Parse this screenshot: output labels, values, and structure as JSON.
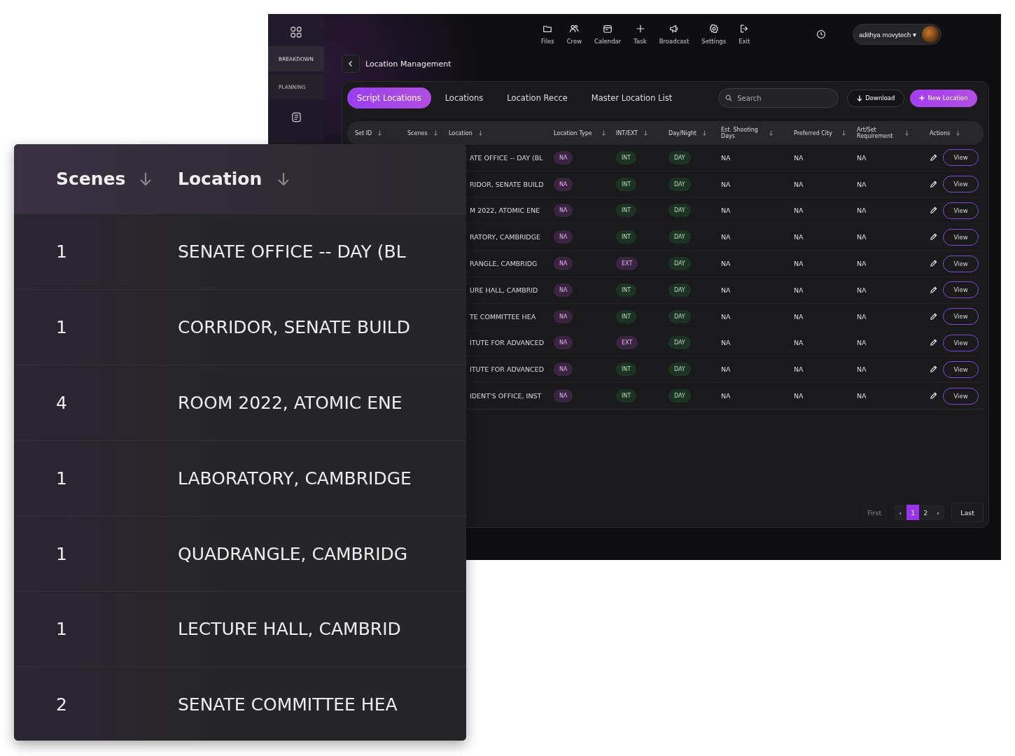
{
  "sidebar": {
    "items": [
      {
        "label": "BREAKDOWN",
        "selected": true
      },
      {
        "label": "PLANNING",
        "selected": false
      }
    ]
  },
  "nav": [
    {
      "label": "Files"
    },
    {
      "label": "Crew"
    },
    {
      "label": "Calendar"
    },
    {
      "label": "Task"
    },
    {
      "label": "Broadcast"
    },
    {
      "label": "Settings"
    },
    {
      "label": "Exit"
    }
  ],
  "user": {
    "name": "adithya movytech ▾"
  },
  "page_title": "Location Management",
  "tabs": [
    {
      "label": "Script Locations",
      "selected": true
    },
    {
      "label": "Locations",
      "selected": false
    },
    {
      "label": "Location Recce",
      "selected": false
    },
    {
      "label": "Master Location List",
      "selected": false
    }
  ],
  "search": {
    "placeholder": "Search"
  },
  "buttons": {
    "download": "Download",
    "new": "New Location"
  },
  "table": {
    "columns": [
      "Set ID",
      "Scenes",
      "Location",
      "Location Type",
      "INT/EXT",
      "Day/Night",
      "Est. Shooting Days",
      "Preferred City",
      "Art/Set Requirement",
      "Actions"
    ],
    "rows": [
      {
        "location": "ATE OFFICE -- DAY (BL",
        "location_type": "NA",
        "setting": {
          "label": "INT",
          "kind": "interior"
        },
        "time": "DAY",
        "days": "NA",
        "city": "NA",
        "art": "NA",
        "action": "View"
      },
      {
        "location": "RIDOR, SENATE BUILD",
        "location_type": "NA",
        "setting": {
          "label": "INT",
          "kind": "interior"
        },
        "time": "DAY",
        "days": "NA",
        "city": "NA",
        "art": "NA",
        "action": "View"
      },
      {
        "location": "M 2022, ATOMIC ENE",
        "location_type": "NA",
        "setting": {
          "label": "INT",
          "kind": "interior"
        },
        "time": "DAY",
        "days": "NA",
        "city": "NA",
        "art": "NA",
        "action": "View"
      },
      {
        "location": "RATORY, CAMBRIDGE",
        "location_type": "NA",
        "setting": {
          "label": "INT",
          "kind": "interior"
        },
        "time": "DAY",
        "days": "NA",
        "city": "NA",
        "art": "NA",
        "action": "View"
      },
      {
        "location": "RANGLE, CAMBRIDG",
        "location_type": "NA",
        "setting": {
          "label": "EXT",
          "kind": "exterior"
        },
        "time": "DAY",
        "days": "NA",
        "city": "NA",
        "art": "NA",
        "action": "View"
      },
      {
        "location": "URE HALL, CAMBRID",
        "location_type": "NA",
        "setting": {
          "label": "INT",
          "kind": "interior"
        },
        "time": "DAY",
        "days": "NA",
        "city": "NA",
        "art": "NA",
        "action": "View"
      },
      {
        "location": "TE COMMITTEE HEA",
        "location_type": "NA",
        "setting": {
          "label": "INT",
          "kind": "interior"
        },
        "time": "DAY",
        "days": "NA",
        "city": "NA",
        "art": "NA",
        "action": "View"
      },
      {
        "location": "ITUTE FOR ADVANCED",
        "location_type": "NA",
        "setting": {
          "label": "EXT",
          "kind": "exterior"
        },
        "time": "DAY",
        "days": "NA",
        "city": "NA",
        "art": "NA",
        "action": "View"
      },
      {
        "location": "ITUTE FOR ADVANCED",
        "location_type": "NA",
        "setting": {
          "label": "INT",
          "kind": "interior"
        },
        "time": "DAY",
        "days": "NA",
        "city": "NA",
        "art": "NA",
        "action": "View"
      },
      {
        "location": "IDENT'S OFFICE, INST",
        "location_type": "NA",
        "setting": {
          "label": "INT",
          "kind": "interior"
        },
        "time": "DAY",
        "days": "NA",
        "city": "NA",
        "art": "NA",
        "action": "View"
      }
    ]
  },
  "pagination": {
    "first": "First",
    "prev": "‹",
    "pages": [
      {
        "label": "1",
        "selected": true
      },
      {
        "label": "2",
        "selected": false
      }
    ],
    "next": "›",
    "last": "Last"
  },
  "inset": {
    "columns": [
      "Scenes",
      "Location"
    ],
    "rows": [
      {
        "scenes": "1",
        "location": "SENATE OFFICE -- DAY (BL"
      },
      {
        "scenes": "1",
        "location": "CORRIDOR, SENATE BUILD"
      },
      {
        "scenes": "4",
        "location": "ROOM 2022, ATOMIC ENE"
      },
      {
        "scenes": "1",
        "location": "LABORATORY, CAMBRIDGE"
      },
      {
        "scenes": "1",
        "location": "QUADRANGLE, CAMBRIDG"
      },
      {
        "scenes": "1",
        "location": "LECTURE HALL, CAMBRID"
      },
      {
        "scenes": "2",
        "location": "SENATE COMMITTEE HEA"
      }
    ]
  }
}
